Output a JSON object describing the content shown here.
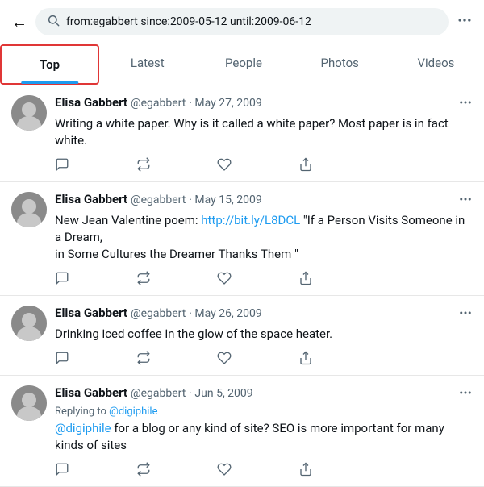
{
  "header": {
    "back_label": "←",
    "search_query": "from:egabbert since:2009-05-12 until:2009-06-12",
    "more_label": "···"
  },
  "tabs": [
    {
      "id": "top",
      "label": "Top",
      "active": true
    },
    {
      "id": "latest",
      "label": "Latest",
      "active": false
    },
    {
      "id": "people",
      "label": "People",
      "active": false
    },
    {
      "id": "photos",
      "label": "Photos",
      "active": false
    },
    {
      "id": "videos",
      "label": "Videos",
      "active": false
    }
  ],
  "tweets": [
    {
      "id": 1,
      "author_name": "Elisa Gabbert",
      "author_handle": "@egabbert",
      "date": "· May 27, 2009",
      "text": "Writing a white paper. Why is it called a white paper? Most paper is in fact white.",
      "reply_icon": "reply",
      "retweet_icon": "retweet",
      "like_icon": "like",
      "share_icon": "share",
      "has_mention": false,
      "has_reply_to": false
    },
    {
      "id": 2,
      "author_name": "Elisa Gabbert",
      "author_handle": "@egabbert",
      "date": "· May 15, 2009",
      "text": "New Jean Valentine poem: http://bit.ly/L8DCL \"If a Person Visits Someone in a Dream,\nin Some Cultures the Dreamer Thanks Them \"",
      "link_text": "http://bit.ly/L8DCL",
      "has_mention": false,
      "has_reply_to": false
    },
    {
      "id": 3,
      "author_name": "Elisa Gabbert",
      "author_handle": "@egabbert",
      "date": "· May 26, 2009",
      "text": "Drinking iced coffee in the glow of the space heater.",
      "has_mention": false,
      "has_reply_to": false
    },
    {
      "id": 4,
      "author_name": "Elisa Gabbert",
      "author_handle": "@egabbert",
      "date": "· Jun 5, 2009",
      "text": "@digiphile  for a blog or any kind of site? SEO is more important for many kinds of sites",
      "reply_to": "@digiphile",
      "mention": "@digiphile",
      "has_mention": true,
      "has_reply_to": true,
      "reply_label": "Replying to",
      "reply_to_handle": "@digiphile"
    }
  ],
  "icons": {
    "search": "🔍",
    "back": "←",
    "more": "···"
  }
}
